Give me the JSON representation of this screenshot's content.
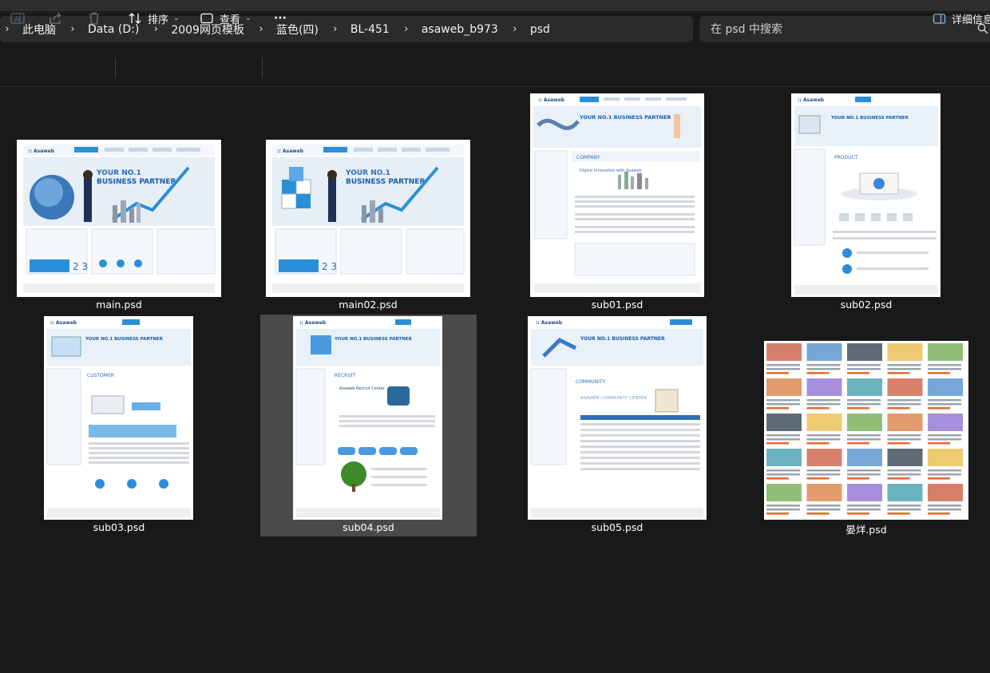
{
  "breadcrumb": {
    "items": [
      "此电脑",
      "Data (D:)",
      "2009网页模板",
      "蓝色(四)",
      "BL-451",
      "asaweb_b973",
      "psd"
    ]
  },
  "search": {
    "placeholder": "在 psd 中搜索"
  },
  "commandbar": {
    "sort_label": "排序",
    "view_label": "查看",
    "more_label": "···",
    "details_label": "详细信息"
  },
  "files": [
    {
      "name": "main.psd",
      "thumb_title": "YOUR NO.1 BUSINESS PARTNER",
      "brand": "Asaweb"
    },
    {
      "name": "main02.psd",
      "thumb_title": "YOUR NO.1 BUSINESS PARTNER",
      "brand": "Asaweb"
    },
    {
      "name": "sub01.psd",
      "thumb_title": "COMPANY",
      "brand": "Asaweb"
    },
    {
      "name": "sub02.psd",
      "thumb_title": "PRODUCT",
      "brand": "Asaweb"
    },
    {
      "name": "sub03.psd",
      "thumb_title": "CUSTOMER",
      "brand": "Asaweb"
    },
    {
      "name": "sub04.psd",
      "thumb_title": "RECRUIT",
      "brand": "Asaweb",
      "selected": true
    },
    {
      "name": "sub05.psd",
      "thumb_title": "COMMUNITY",
      "brand": "Asaweb"
    },
    {
      "name": "晏烊.psd",
      "thumb_title": "",
      "brand": ""
    }
  ],
  "colors": {
    "background": "#191919",
    "accent": "#2a8fd8",
    "selected": "#4a4a4a"
  }
}
